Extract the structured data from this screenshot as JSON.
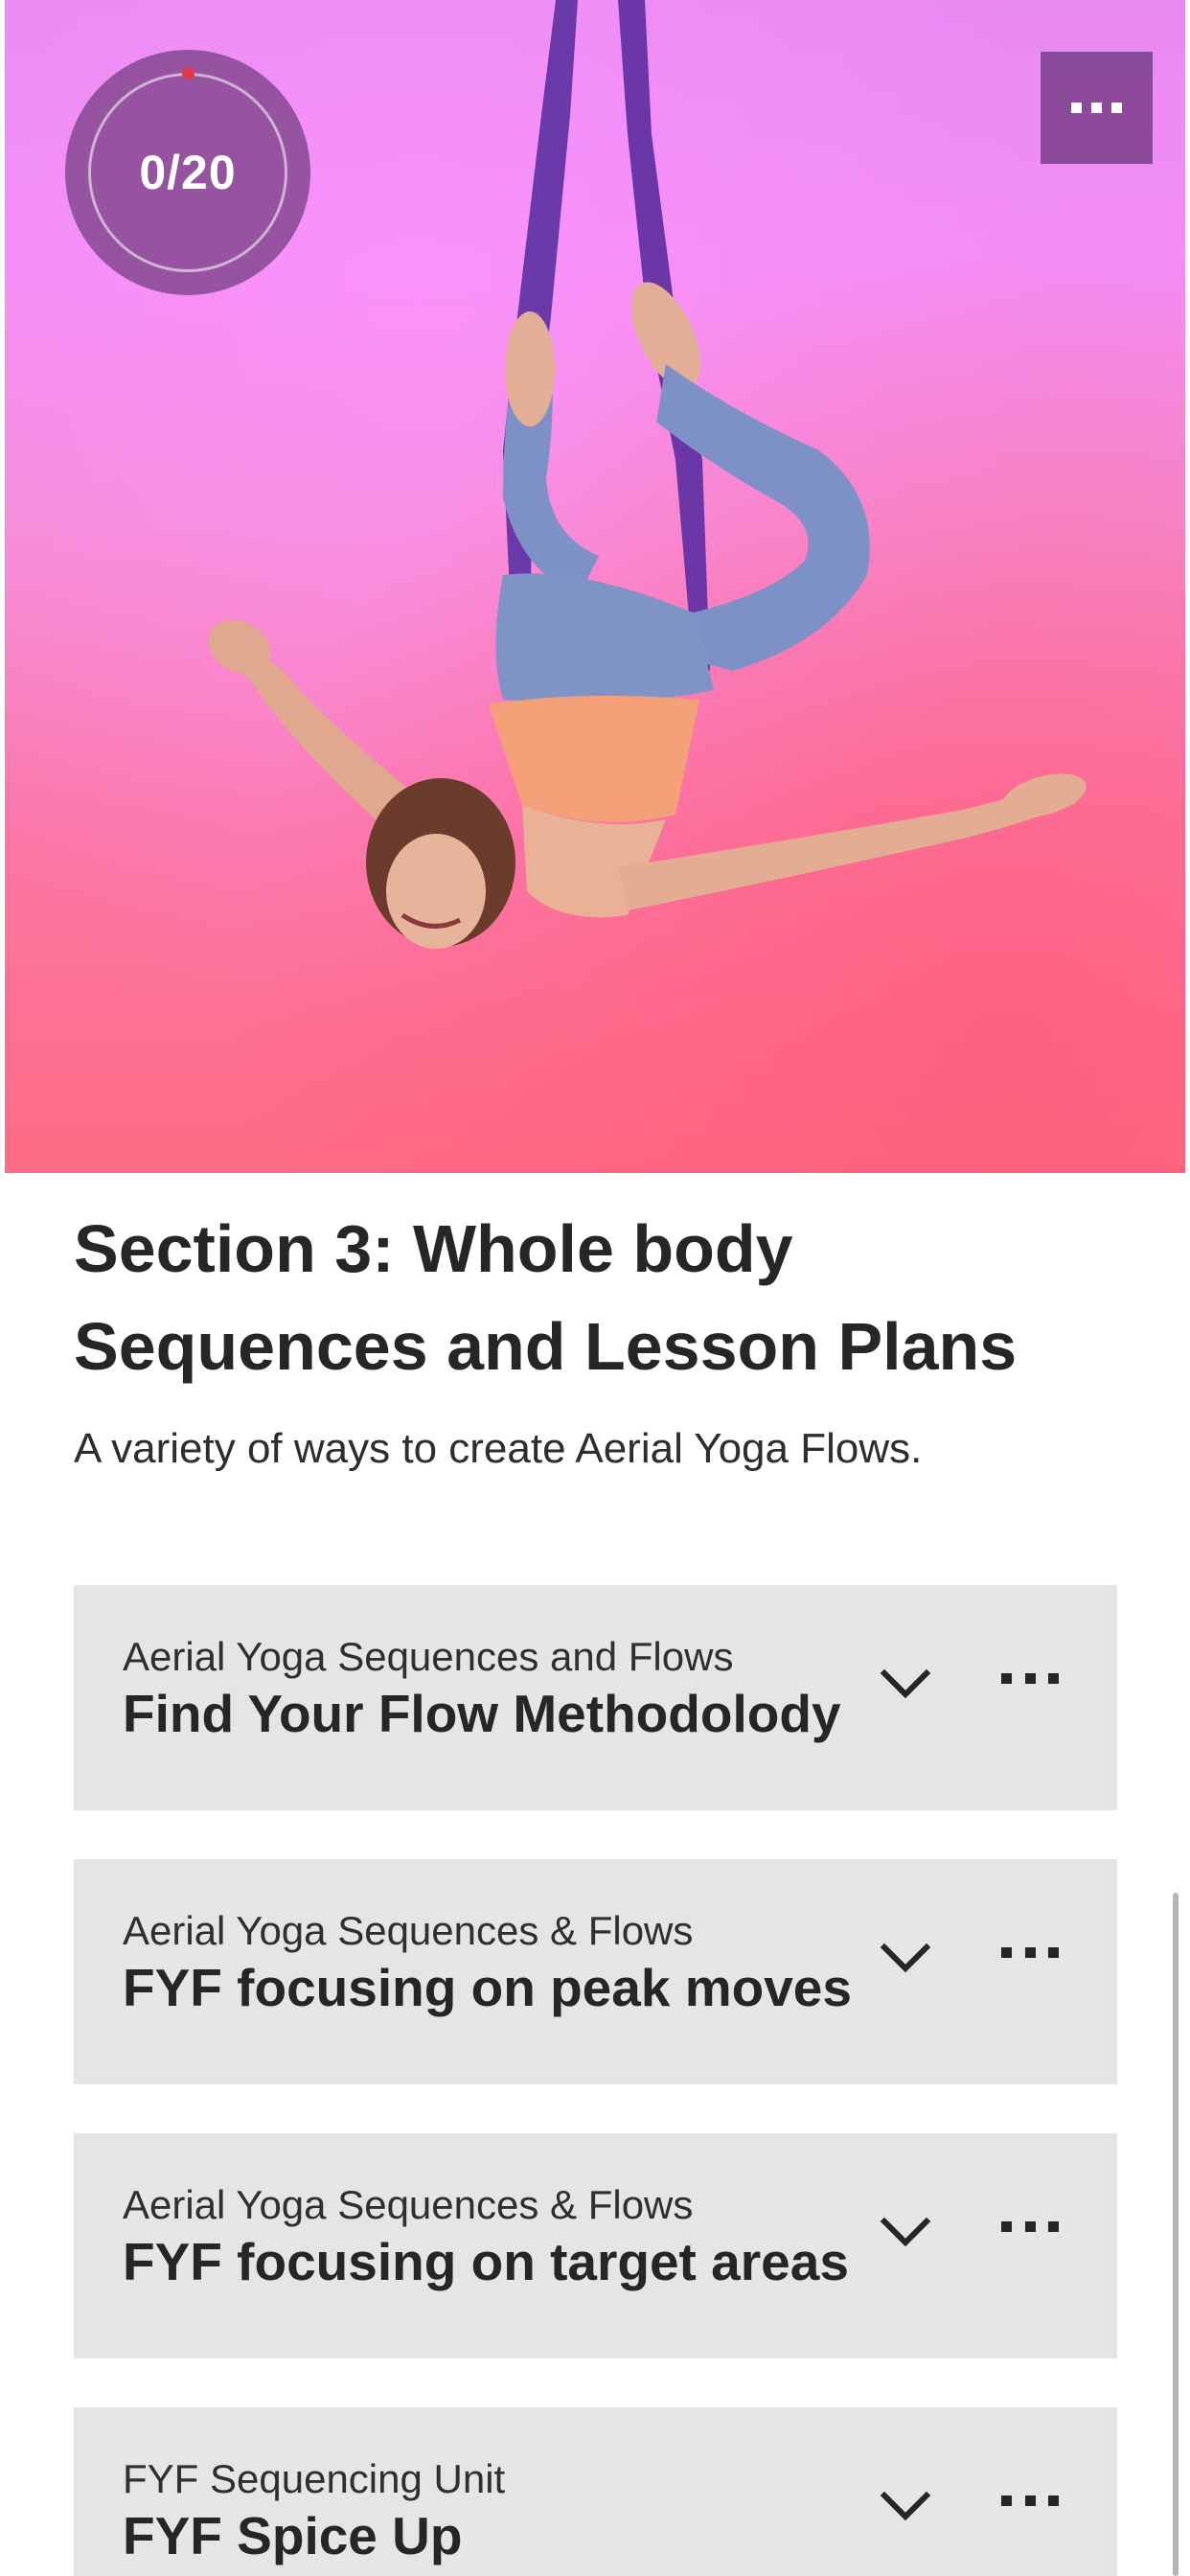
{
  "hero": {
    "progress_text": "0/20",
    "progress_fraction": 0,
    "menu_icon": "more-horizontal-icon",
    "image_subject": "aerial-yoga-pose-photo"
  },
  "section": {
    "title": "Section 3: Whole body Sequences and Lesson Plans",
    "subtitle": "A variety of ways to create Aerial Yoga Flows."
  },
  "lessons": [
    {
      "kicker": "Aerial Yoga Sequences and Flows",
      "title": "Find Your Flow Methodolody",
      "expand_icon": "chevron-down-icon",
      "more_icon": "more-horizontal-icon"
    },
    {
      "kicker": "Aerial Yoga Sequences & Flows",
      "title": "FYF focusing on peak moves",
      "expand_icon": "chevron-down-icon",
      "more_icon": "more-horizontal-icon"
    },
    {
      "kicker": "Aerial Yoga Sequences & Flows",
      "title": "FYF focusing on target areas",
      "expand_icon": "chevron-down-icon",
      "more_icon": "more-horizontal-icon"
    },
    {
      "kicker": "FYF Sequencing Unit",
      "title": "FYF Spice Up",
      "expand_icon": "chevron-down-icon",
      "more_icon": "more-horizontal-icon"
    }
  ],
  "colors": {
    "hero_top": "#e78af2",
    "hero_bottom": "#fe6b84",
    "overlay": "#80468c",
    "card_background": "#e7e4e5",
    "progress_dot": "#e2384e",
    "text": "#262626"
  }
}
